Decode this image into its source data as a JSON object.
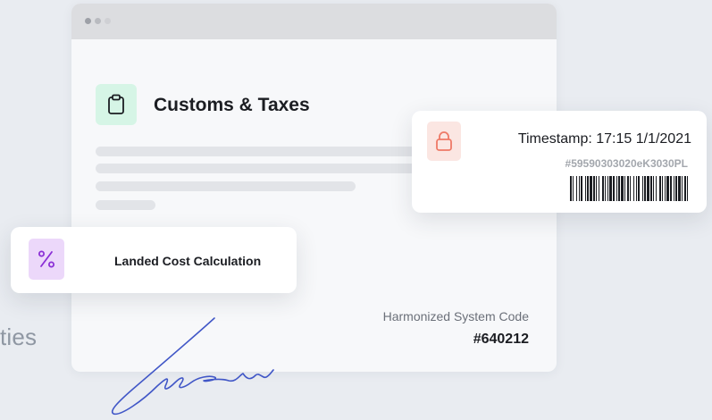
{
  "background_text": "ties",
  "document": {
    "title": "Customs & Taxes",
    "hs_label": "Harmonized System Code",
    "hs_code": "#640212"
  },
  "timestamp_card": {
    "timestamp": "Timestamp: 17:15   1/1/2021",
    "hash": "#59590303020eK3030PL"
  },
  "landed_card": {
    "label": "Landed Cost Calculation"
  },
  "icons": {
    "document": "clipboard-icon",
    "timestamp": "lock-icon",
    "landed": "percent-icon"
  },
  "colors": {
    "accent_green": "#2fae7a",
    "accent_red": "#ee7a67",
    "accent_purple": "#8b2fd6",
    "signature_blue": "#4157c7"
  }
}
